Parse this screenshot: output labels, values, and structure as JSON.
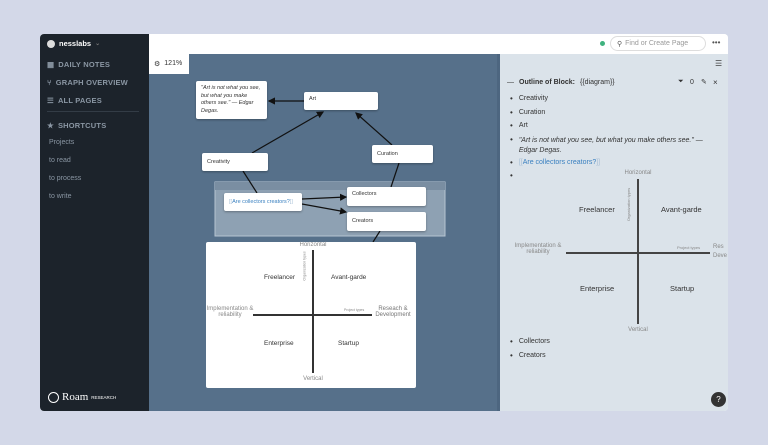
{
  "sidebar": {
    "workspace": "nesslabs",
    "nav": [
      {
        "icon": "calendar-icon",
        "label": "DAILY NOTES"
      },
      {
        "icon": "graph-icon",
        "label": "GRAPH OVERVIEW"
      },
      {
        "icon": "list-icon",
        "label": "ALL PAGES"
      }
    ],
    "shortcuts_label": "SHORTCUTS",
    "shortcuts": [
      "Projects",
      "to read",
      "to process",
      "to write"
    ],
    "logo": "Roam RESEARCH"
  },
  "topbar": {
    "search_placeholder": "Find or Create Page",
    "status_color": "#3fb27f"
  },
  "canvas": {
    "zoom": "121%",
    "nodes": {
      "quote": "\"Art is not what you see, but what you make others see.\" — Edgar Degas.",
      "art": "Art",
      "creativity": "Creativity",
      "curation": "Curation",
      "question": "Are collectors creators?",
      "collectors": "Collectors",
      "creators": "Creators"
    }
  },
  "quadrant": {
    "top": "Horizontal",
    "bottom": "Vertical",
    "left": "Implementation & reliability",
    "right": "Reseach & Development",
    "y_axis": "Organization types",
    "x_axis": "Project types",
    "q1": "Freelancer",
    "q2": "Avant-garde",
    "q3": "Enterprise",
    "q4": "Startup",
    "right_clipped": "Res Deve"
  },
  "panel": {
    "title_bold": "Outline of Block:",
    "title_rest": "{{diagram}}",
    "filter_count": "0",
    "items": [
      "Creativity",
      "Curation",
      "Art",
      "\"Art is not what you see, but what you make others see.\" — Edgar Degas.",
      "Are collectors creators?",
      "Collectors",
      "Creators"
    ]
  },
  "help": "?"
}
